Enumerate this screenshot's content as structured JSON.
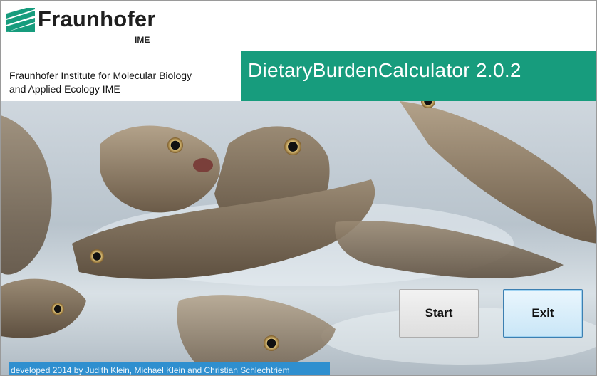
{
  "header": {
    "logo_word": "Fraunhofer",
    "logo_sub": "IME",
    "institute_line1": "Fraunhofer Institute for Molecular Biology",
    "institute_line2": "and Applied Ecology IME",
    "app_title": "DietaryBurdenCalculator 2.0.2"
  },
  "buttons": {
    "start_label": "Start",
    "exit_label": "Exit"
  },
  "footer": {
    "credits": "developed 2014 by Judith Klein, Michael Klein and Christian Schlechtriem"
  },
  "colors": {
    "brand_green": "#179c7d",
    "credits_blue": "#2f8fcf"
  },
  "icons": {
    "logo": "fraunhofer-logo-icon",
    "photo": "fish-photo"
  }
}
